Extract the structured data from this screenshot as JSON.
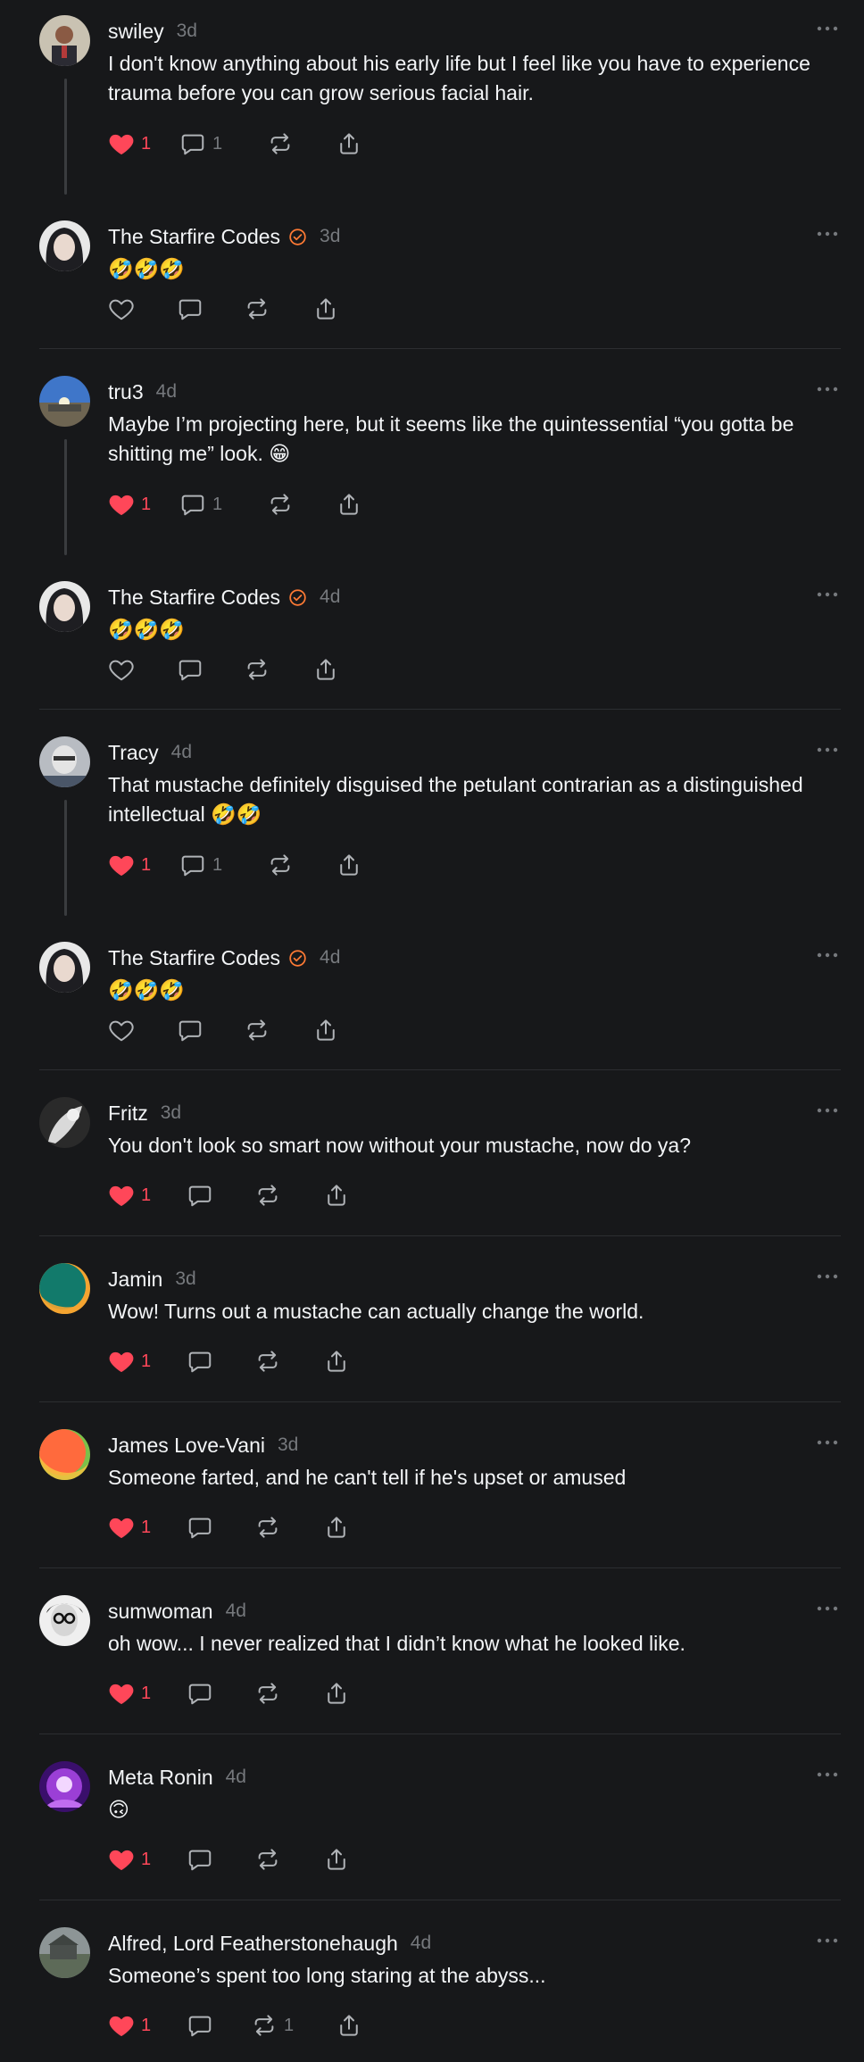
{
  "colors": {
    "background": "#17181a",
    "text": "#f3f5f7",
    "muted": "#76797d",
    "like": "#ff4759",
    "verified": "#ff7a34",
    "divider": "#2c2e31"
  },
  "posts": [
    {
      "user": "swiley",
      "time": "3d",
      "verified": false,
      "text": "I don't know anything about his early life but I feel like you have to experience trauma before you can grow serious facial hair.",
      "liked": true,
      "likes": "1",
      "replies": "1",
      "reposts": ""
    },
    {
      "user": "The Starfire Codes",
      "time": "3d",
      "verified": true,
      "text": "🤣🤣🤣",
      "liked": false,
      "likes": "",
      "replies": "",
      "reposts": ""
    },
    {
      "user": "tru3",
      "time": "4d",
      "verified": false,
      "text": "Maybe I’m projecting here, but it seems like the quintessential “you gotta be shitting me” look. 😁",
      "liked": true,
      "likes": "1",
      "replies": "1",
      "reposts": ""
    },
    {
      "user": "The Starfire Codes",
      "time": "4d",
      "verified": true,
      "text": "🤣🤣🤣",
      "liked": false,
      "likes": "",
      "replies": "",
      "reposts": ""
    },
    {
      "user": "Tracy",
      "time": "4d",
      "verified": false,
      "text": "That mustache definitely disguised the petulant contrarian as a distinguished intellectual 🤣🤣",
      "liked": true,
      "likes": "1",
      "replies": "1",
      "reposts": ""
    },
    {
      "user": "The Starfire Codes",
      "time": "4d",
      "verified": true,
      "text": "🤣🤣🤣",
      "liked": false,
      "likes": "",
      "replies": "",
      "reposts": ""
    },
    {
      "user": "Fritz",
      "time": "3d",
      "verified": false,
      "text": "You don't look so smart now without your mustache, now do ya?",
      "liked": true,
      "likes": "1",
      "replies": "",
      "reposts": ""
    },
    {
      "user": "Jamin",
      "time": "3d",
      "verified": false,
      "text": "Wow! Turns out a mustache can actually change the world.",
      "liked": true,
      "likes": "1",
      "replies": "",
      "reposts": ""
    },
    {
      "user": "James Love-Vani",
      "time": "3d",
      "verified": false,
      "text": "Someone farted, and he can't tell if he's upset or amused",
      "liked": true,
      "likes": "1",
      "replies": "",
      "reposts": ""
    },
    {
      "user": "sumwoman",
      "time": "4d",
      "verified": false,
      "text": "oh wow... I never realized that I didn’t know what he looked like.",
      "liked": true,
      "likes": "1",
      "replies": "",
      "reposts": ""
    },
    {
      "user": "Meta Ronin",
      "time": "4d",
      "verified": false,
      "text": "🙃",
      "liked": true,
      "likes": "1",
      "replies": "",
      "reposts": ""
    },
    {
      "user": "Alfred, Lord Featherstonehaugh",
      "time": "4d",
      "verified": false,
      "text": "Someone’s spent too long staring at the abyss...",
      "liked": true,
      "likes": "1",
      "replies": "",
      "reposts": "1"
    }
  ]
}
